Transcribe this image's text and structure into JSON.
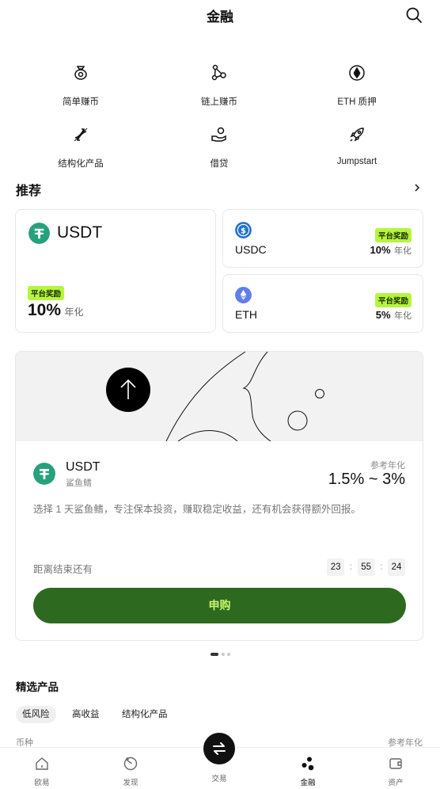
{
  "header": {
    "title": "金融"
  },
  "quick_actions": [
    {
      "label": "简单赚币",
      "icon": "money-bag-icon"
    },
    {
      "label": "链上赚币",
      "icon": "chain-nodes-icon"
    },
    {
      "label": "ETH 质押",
      "icon": "eth-coin-icon"
    },
    {
      "label": "结构化产品",
      "icon": "structured-arrows-icon"
    },
    {
      "label": "借贷",
      "icon": "hand-coin-icon"
    },
    {
      "label": "Jumpstart",
      "icon": "rocket-icon"
    }
  ],
  "recommend": {
    "title": "推荐",
    "cards": [
      {
        "coin": "USDT",
        "badge": "平台奖励",
        "rate": "10%",
        "unit": "年化",
        "color": "#26a17b"
      },
      {
        "coin": "USDC",
        "badge": "平台奖励",
        "rate": "10%",
        "unit": "年化",
        "color": "#2775ca"
      },
      {
        "coin": "ETH",
        "badge": "平台奖励",
        "rate": "5%",
        "unit": "年化",
        "color": "#627eea"
      }
    ]
  },
  "banner": {
    "coin": "USDT",
    "product": "鲨鱼鳍",
    "ref_label": "参考年化",
    "rate": "1.5% ~ 3%",
    "description": "选择 1 天鲨鱼鳍，专注保本投资，赚取稳定收益，还有机会获得额外回报。",
    "countdown_label": "距离结束还有",
    "countdown": [
      "23",
      "55",
      "24"
    ],
    "separator": ":",
    "button": "申购",
    "button_color": "#2d6a1f"
  },
  "featured": {
    "title": "精选产品",
    "tabs": [
      "低风险",
      "高收益",
      "结构化产品"
    ],
    "col_left": "币种",
    "col_right": "参考年化"
  },
  "tabbar": {
    "items": [
      {
        "label": "欧易",
        "icon": "home-icon"
      },
      {
        "label": "发现",
        "icon": "discover-icon"
      },
      {
        "label": "交易",
        "icon": "swap-icon"
      },
      {
        "label": "金融",
        "icon": "finance-dots-icon"
      },
      {
        "label": "资产",
        "icon": "wallet-icon"
      }
    ]
  }
}
